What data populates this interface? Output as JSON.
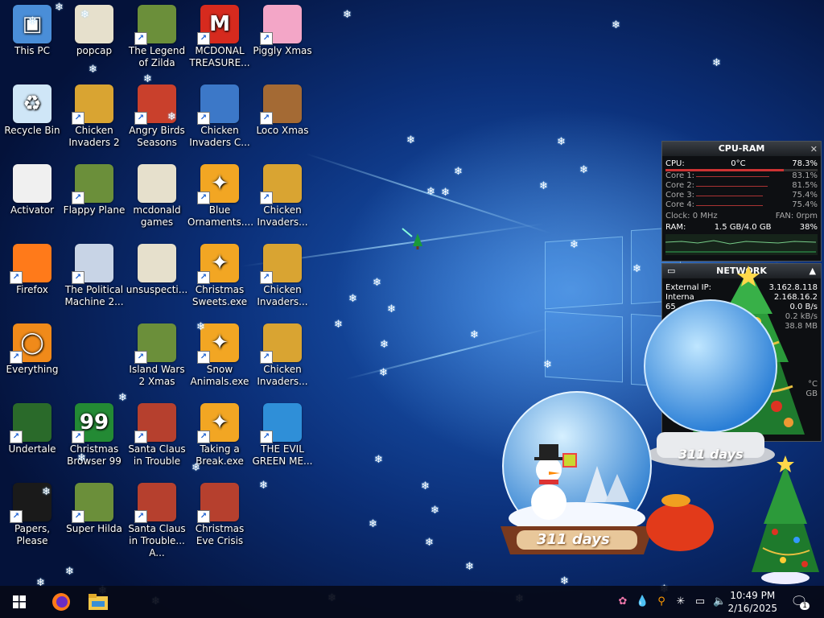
{
  "desktop_icons": [
    {
      "label": "This PC",
      "icon": "computer-icon"
    },
    {
      "label": "popcap",
      "icon": "folder-icon"
    },
    {
      "label": "The Legend of Zilda",
      "icon": "game-icon"
    },
    {
      "label": "MCDONAL TREASURE...",
      "icon": "mcdonalds-logo-icon"
    },
    {
      "label": "Piggly Xmas",
      "icon": "pig-icon"
    },
    {
      "label": "Recycle Bin",
      "icon": "recycle-bin-icon"
    },
    {
      "label": "Chicken Invaders 2",
      "icon": "chicken-icon"
    },
    {
      "label": "Angry Birds Seasons",
      "icon": "angry-bird-icon"
    },
    {
      "label": "Chicken Invaders C...",
      "icon": "snowman-icon"
    },
    {
      "label": "Loco Xmas",
      "icon": "bear-icon"
    },
    {
      "label": "Activator",
      "icon": "file-icon"
    },
    {
      "label": "Flappy Plane",
      "icon": "game-icon"
    },
    {
      "label": "mcdonald games",
      "icon": "folder-icon"
    },
    {
      "label": "Blue Ornaments....",
      "icon": "exe-icon"
    },
    {
      "label": "Chicken Invaders...",
      "icon": "chicken-icon"
    },
    {
      "label": "Firefox",
      "icon": "firefox-icon"
    },
    {
      "label": "The Political Machine 2...",
      "icon": "political-icon"
    },
    {
      "label": "unsuspecti...",
      "icon": "folder-icon"
    },
    {
      "label": "Christmas Sweets.exe",
      "icon": "exe-icon"
    },
    {
      "label": "Chicken Invaders...",
      "icon": "chicken-icon"
    },
    {
      "label": "Everything",
      "icon": "search-icon"
    },
    {
      "label": "Island Wars 2 Xmas",
      "icon": "game-icon"
    },
    {
      "label": "Snow Animals.exe",
      "icon": "exe-icon"
    },
    {
      "label": "Chicken Invaders...",
      "icon": "chicken-icon"
    },
    {
      "label": "Undertale",
      "icon": "undertale-icon"
    },
    {
      "label": "Christmas Browser 99",
      "icon": "christmas-tree-icon"
    },
    {
      "label": "Santa Claus in Trouble",
      "icon": "santa-icon"
    },
    {
      "label": "Taking a Break.exe",
      "icon": "exe-icon"
    },
    {
      "label": "THE EVIL GREEN ME...",
      "icon": "messenger-icon"
    },
    {
      "label": "Papers, Please",
      "icon": "papers-please-icon"
    },
    {
      "label": "Super Hilda",
      "icon": "game-icon"
    },
    {
      "label": "Santa Claus in Trouble... A...",
      "icon": "santa-icon"
    },
    {
      "label": "Christmas Eve Crisis",
      "icon": "santa-icon"
    }
  ],
  "cpu_gadget": {
    "title": "CPU-RAM",
    "cpu_label": "CPU:",
    "cpu_temp": "0°C",
    "cpu_value": "78.3%",
    "cores": [
      {
        "label": "Core 1:",
        "value": "83.1%"
      },
      {
        "label": "Core 2:",
        "value": "81.5%"
      },
      {
        "label": "Core 3:",
        "value": "75.4%"
      },
      {
        "label": "Core 4:",
        "value": "75.4%"
      }
    ],
    "clock": "Clock: 0 MHz",
    "fan": "FAN: 0rpm",
    "ram_label": "RAM:",
    "ram_value": "1.5 GB/4.0 GB",
    "ram_percent": "38%"
  },
  "network_gadget": {
    "title": "NETWORK",
    "external_label": "External IP:",
    "external_value": "3.162.8.118",
    "internal_label": "Interna",
    "internal_value": "2.168.16.2",
    "speed1_label": "65",
    "speed1": "0.0 B/s",
    "speed2": "0.2 kB/s",
    "speed3": "38.8 MB",
    "temp": "°C",
    "unit": "GB"
  },
  "snowglobes": [
    {
      "days_label": "311 days"
    },
    {
      "days_label": "311 days"
    }
  ],
  "taskbar": {
    "time": "10:49 PM",
    "date": "2/16/2025",
    "notification_count": "1",
    "pinned": [
      {
        "name": "firefox-taskbar-icon"
      },
      {
        "name": "file-explorer-taskbar-icon"
      }
    ],
    "tray": [
      "puzzle-icon",
      "drop-icon",
      "search-tray-icon",
      "snowflake-tray-icon",
      "network-icon",
      "volume-muted-icon"
    ]
  },
  "colors": {
    "taskbar_bg": "#060a18",
    "desktop_bg": "#0b2f78",
    "gadget_bg": "#0d0f12",
    "bar_red": "#b33333"
  }
}
